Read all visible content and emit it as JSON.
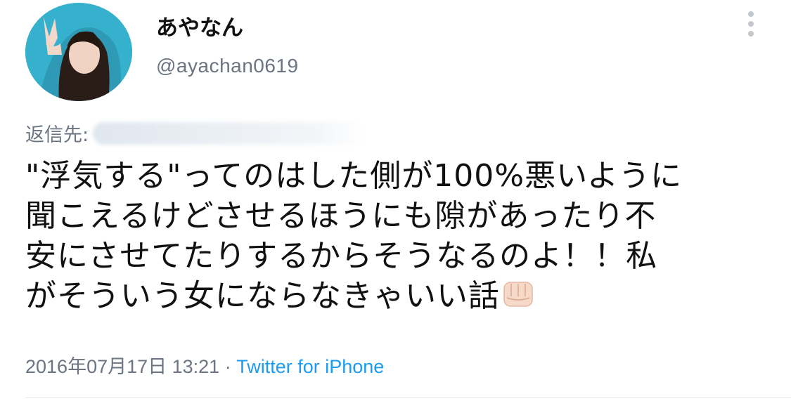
{
  "user": {
    "display_name": "あやなん",
    "handle": "@ayachan0619"
  },
  "reply": {
    "label": "返信先:"
  },
  "tweet": {
    "lines": [
      "\"浮気する\"ってのはした側が100%悪いように",
      "聞こえるけどさせるほうにも隙があったり不",
      "安にさせてたりするからそうなるのよ！！私",
      "がそういう女にならなきゃいい話"
    ],
    "emoji": "fist-emoji"
  },
  "meta": {
    "timestamp": "2016年07月17日 13:21",
    "separator": " · ",
    "source": "Twitter for iPhone"
  },
  "colors": {
    "accent": "#1d9bf0",
    "secondary_text": "#6b7480",
    "avatar_bg": "#37b3cf"
  }
}
